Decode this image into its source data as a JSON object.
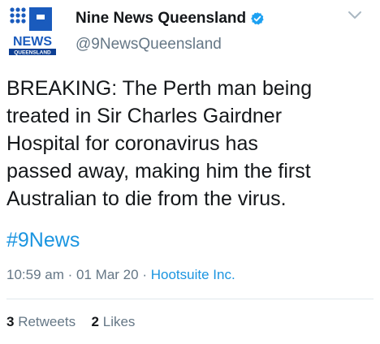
{
  "account": {
    "display_name": "Nine News Queensland",
    "handle": "@9NewsQueensland",
    "verified": true,
    "logo": {
      "brand_text": "NEWS",
      "region_text": "QUEENSLAND",
      "colors": {
        "blue": "#1a5bbd",
        "dark_blue": "#0d3f93"
      }
    }
  },
  "tweet": {
    "text": "BREAKING: The Perth man being\ntreated in Sir Charles Gairdner\nHospital for coronavirus has\npassed away, making him the first\nAustralian to die from the virus.",
    "hashtag": "#9News",
    "time": "10:59 am",
    "date": "01 Mar 20",
    "separator": "·",
    "source": "Hootsuite Inc."
  },
  "stats": {
    "retweets_count": "3",
    "retweets_label": "Retweets",
    "likes_count": "2",
    "likes_label": "Likes"
  },
  "icons": {
    "verified": "verified-badge-icon",
    "menu": "chevron-down-icon"
  },
  "colors": {
    "link": "#1b95e0",
    "secondary_text": "#657786",
    "primary_text": "#14171a",
    "verified": "#1da1f2"
  }
}
